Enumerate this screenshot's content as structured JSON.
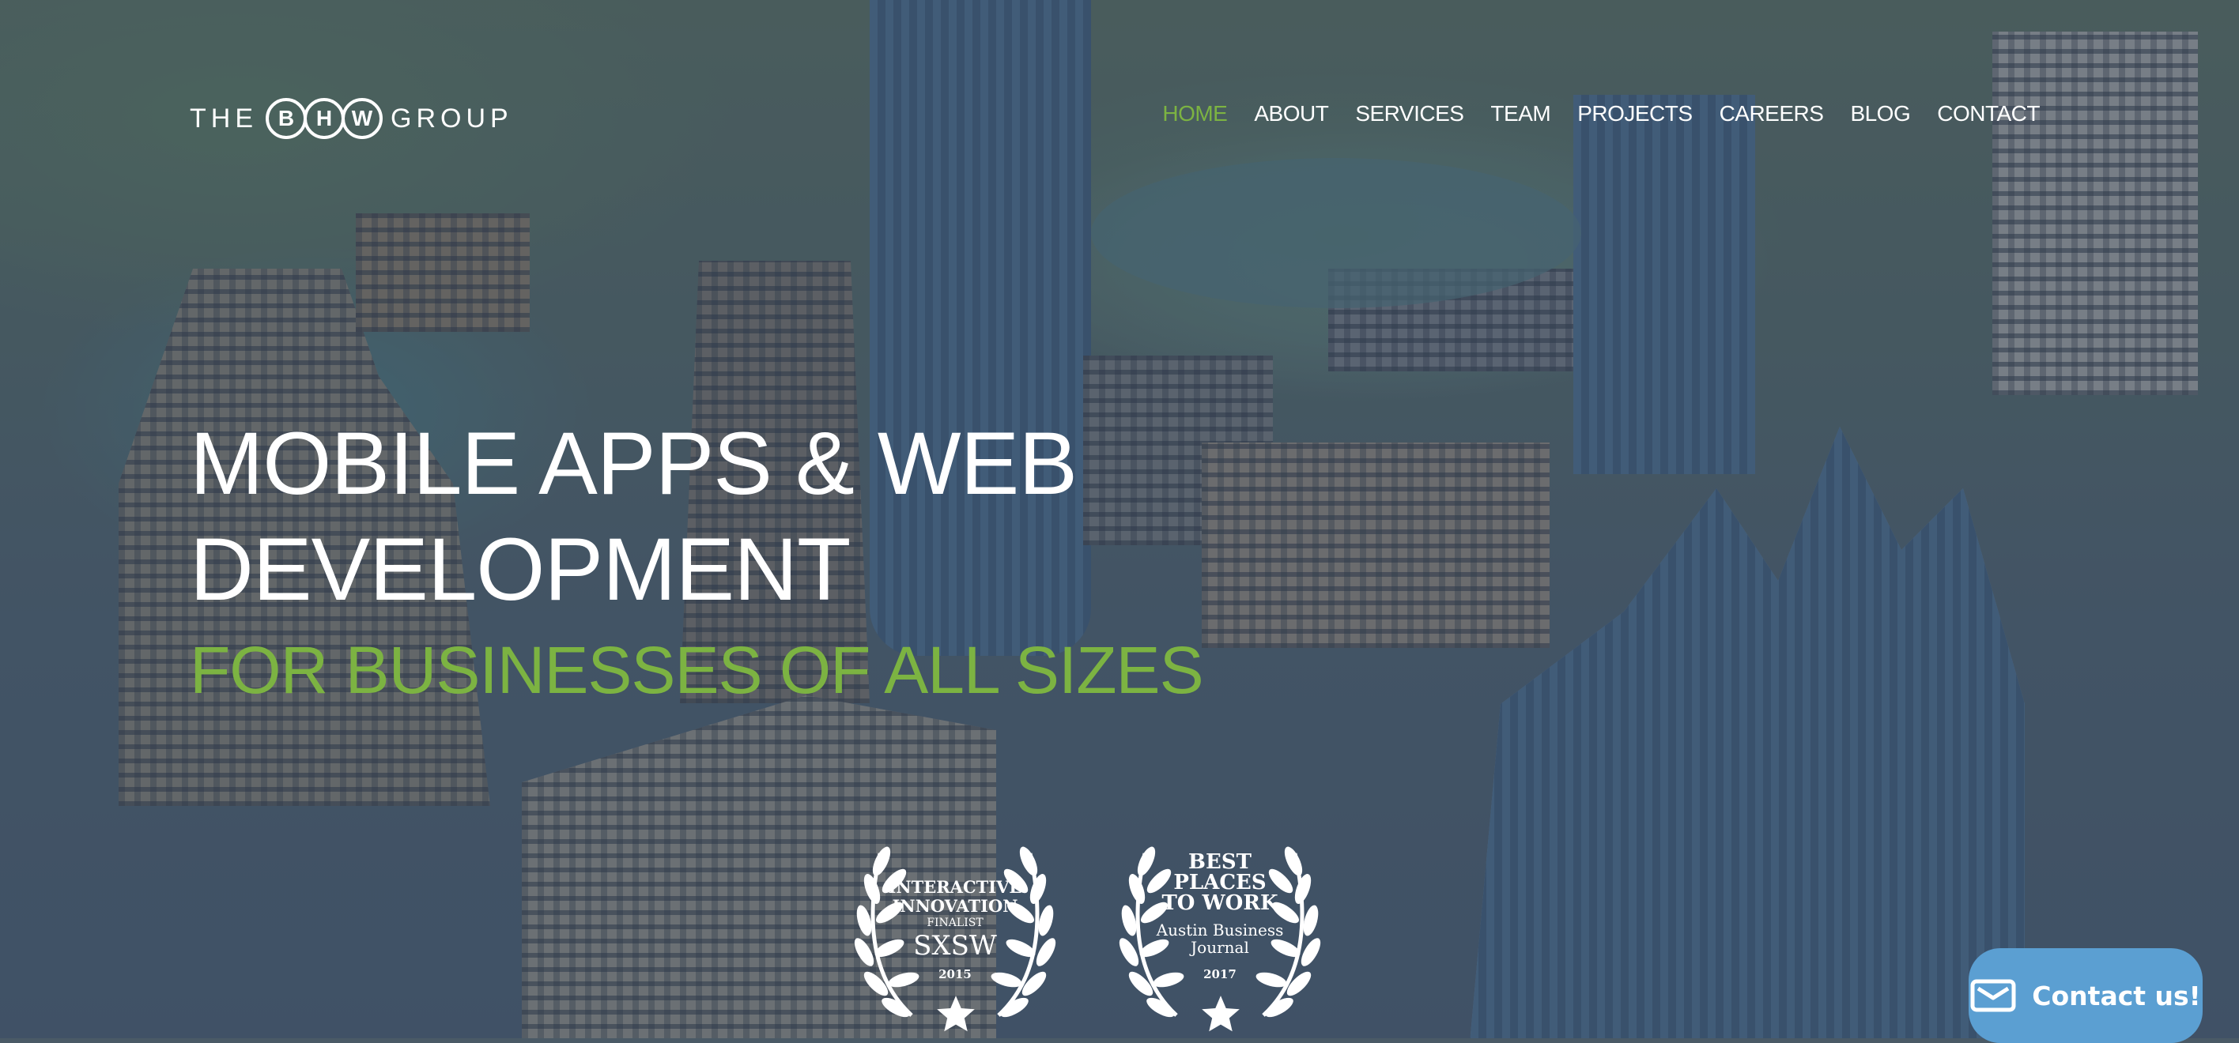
{
  "logo": {
    "prefix": "THE",
    "letters": [
      "B",
      "H",
      "W"
    ],
    "suffix": "GROUP"
  },
  "nav": {
    "items": [
      {
        "label": "HOME",
        "active": true
      },
      {
        "label": "ABOUT",
        "active": false
      },
      {
        "label": "SERVICES",
        "active": false
      },
      {
        "label": "TEAM",
        "active": false
      },
      {
        "label": "PROJECTS",
        "active": false
      },
      {
        "label": "CAREERS",
        "active": false
      },
      {
        "label": "BLOG",
        "active": false
      },
      {
        "label": "CONTACT",
        "active": false
      }
    ]
  },
  "hero": {
    "headline_line1": "MOBILE APPS & WEB",
    "headline_line2": "DEVELOPMENT",
    "subheadline": "FOR BUSINESSES OF ALL SIZES"
  },
  "awards": [
    {
      "line1": "INTERACTIVE",
      "line2": "INNOVATION",
      "line3": "FINALIST",
      "line4": "SXSW",
      "year": "2015",
      "icon": "star-icon"
    },
    {
      "line1": "BEST",
      "line2": "PLACES",
      "line3": "TO WORK",
      "line4": "Austin Business",
      "line5": "Journal",
      "year": "2017",
      "icon": "star-icon"
    }
  ],
  "contact_widget": {
    "label": "Contact us!",
    "icon": "envelope-icon"
  },
  "colors": {
    "accent_green": "#7cb342",
    "contact_blue": "#5b9fd2",
    "overlay": "#344662"
  }
}
